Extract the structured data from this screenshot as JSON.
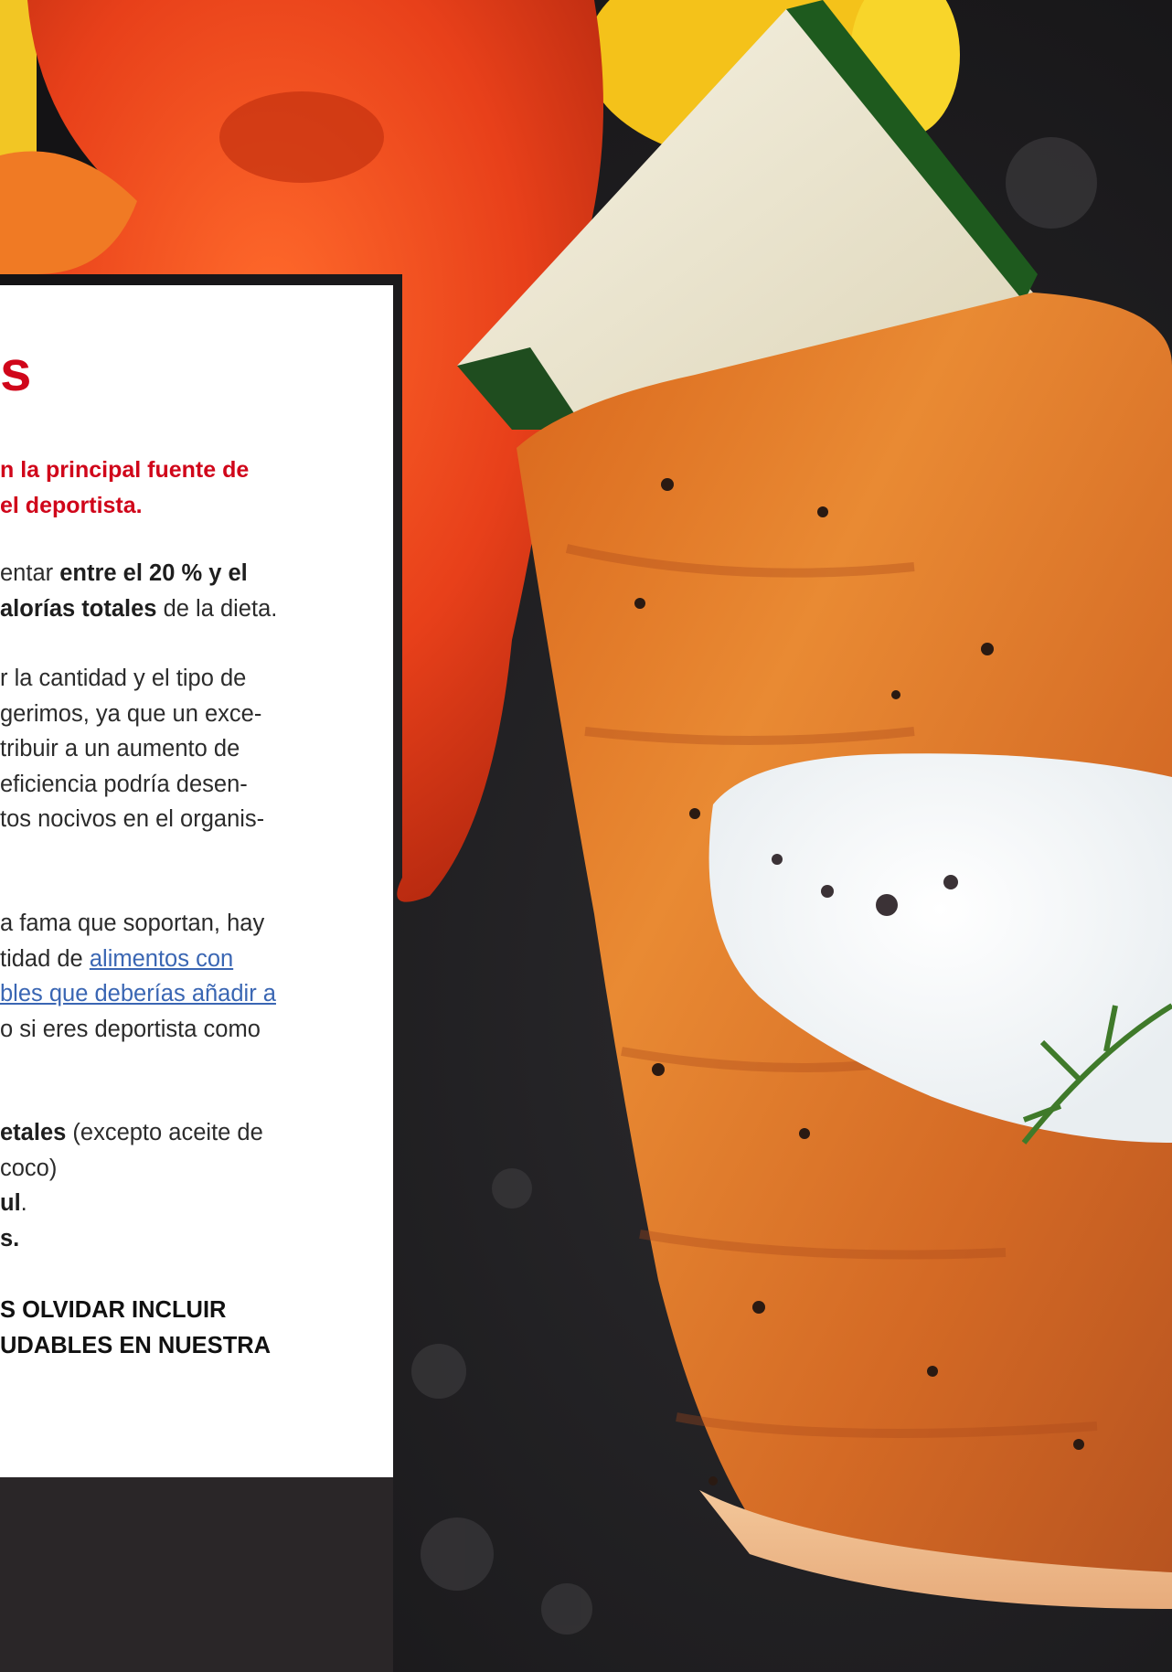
{
  "card": {
    "title": "s",
    "lead_line1": "n la principal fuente de",
    "lead_line2": "el deportista.",
    "p1": [
      {
        "t": "entar ",
        "b": false
      },
      {
        "t": "entre el 20 % y el",
        "b": true
      },
      {
        "t": "alorías totales",
        "b": true
      },
      {
        "t": " de la dieta.",
        "b": false
      }
    ],
    "p2": [
      "r la cantidad y el tipo de",
      "gerimos, ya que un exce-",
      "tribuir a un aumento de",
      "eficiencia podría desen-",
      "tos nocivos en el organis-"
    ],
    "p3_line1": "a fama que soportan, hay",
    "p3_line2_text": "tidad de ",
    "p3_link1": "alimentos con",
    "p3_link2": "bles que deberías añadir a",
    "p3_line4": "o si eres deportista como",
    "list": {
      "item1_bold": "etales",
      "item1_text": " (excepto aceite de",
      "item2_text": "coco)",
      "item3_bold": "ul",
      "item3_text": ".",
      "item4_bold": "s."
    },
    "cta_line1": "S OLVIDAR INCLUIR",
    "cta_line2": "UDABLES EN NUESTRA"
  },
  "colors": {
    "accent_red": "#d0061a",
    "link_blue": "#3a66b3",
    "body_text": "#2b2b2b"
  },
  "image": {
    "description_icon": "salmon-photo"
  }
}
